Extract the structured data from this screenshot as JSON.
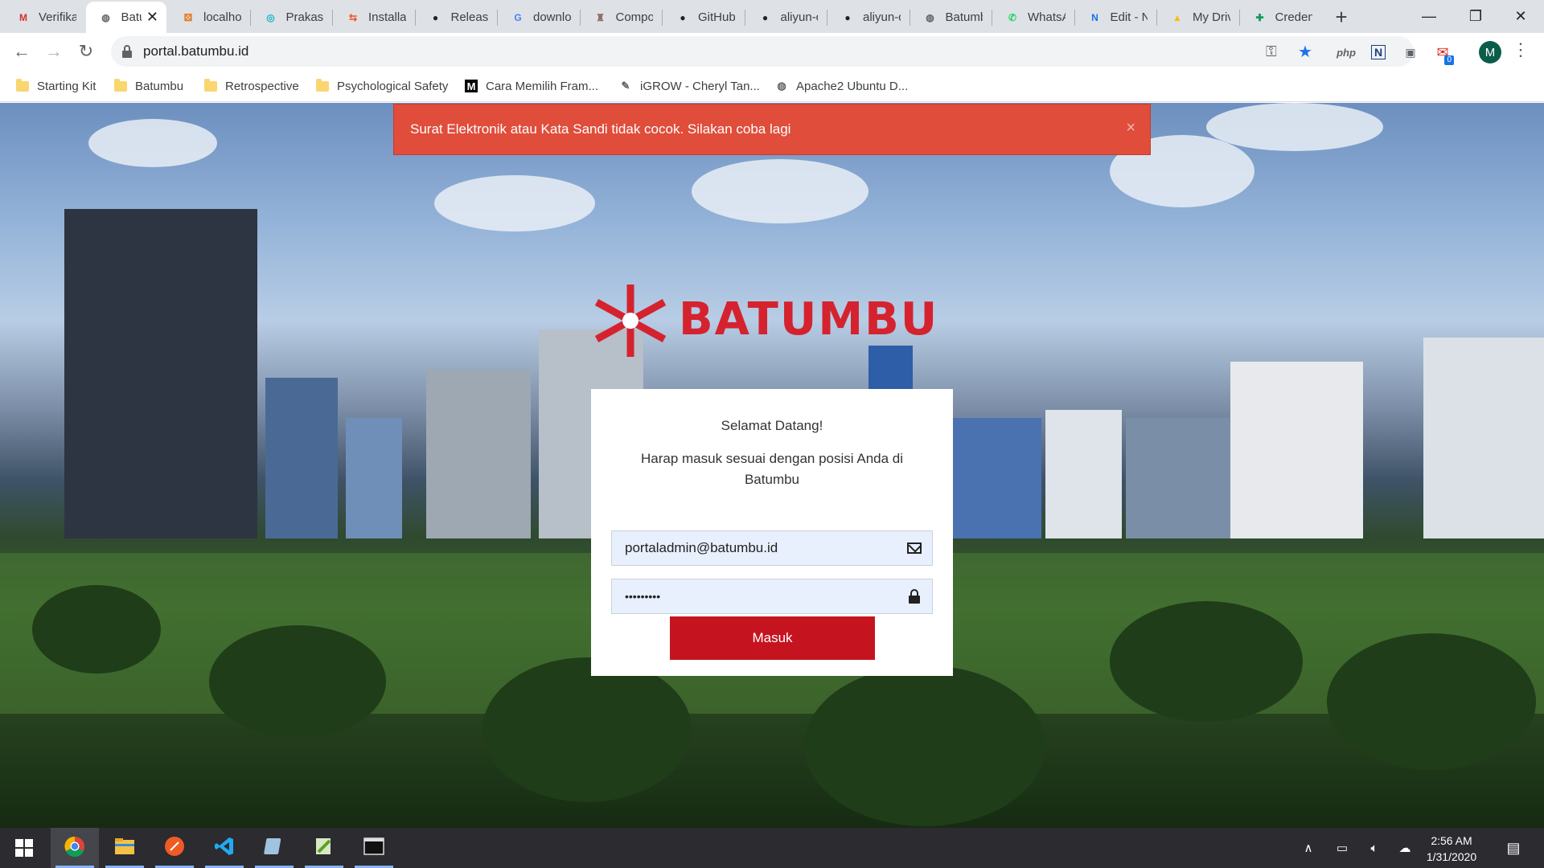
{
  "browser": {
    "tabs": [
      {
        "title": "Verifika",
        "icon": "gmail-icon",
        "color": "#d93025",
        "glyph": "M"
      },
      {
        "title": "Batu",
        "icon": "globe-icon",
        "color": "#5f6368",
        "glyph": "◍",
        "active": true
      },
      {
        "title": "localho",
        "icon": "localhost-icon",
        "color": "#e8710a",
        "glyph": "⚄"
      },
      {
        "title": "Prakash",
        "icon": "prakash-icon",
        "color": "#12b5cb",
        "glyph": "◎"
      },
      {
        "title": "Installat",
        "icon": "installation-icon",
        "color": "#f4511e",
        "glyph": "⇆"
      },
      {
        "title": "Release",
        "icon": "github-icon",
        "color": "#202124",
        "glyph": "●"
      },
      {
        "title": "downlo",
        "icon": "google-icon",
        "color": "#4285f4",
        "glyph": "G"
      },
      {
        "title": "Compo",
        "icon": "composer-icon",
        "color": "#8d6e63",
        "glyph": "♜"
      },
      {
        "title": "GitHub",
        "icon": "github-icon",
        "color": "#202124",
        "glyph": "●"
      },
      {
        "title": "aliyun-c",
        "icon": "github-icon",
        "color": "#202124",
        "glyph": "●"
      },
      {
        "title": "aliyun-c",
        "icon": "github-icon",
        "color": "#202124",
        "glyph": "●"
      },
      {
        "title": "Batumb",
        "icon": "globe-icon",
        "color": "#5f6368",
        "glyph": "◍"
      },
      {
        "title": "WhatsA",
        "icon": "whatsapp-icon",
        "color": "#25d366",
        "glyph": "✆"
      },
      {
        "title": "Edit - N",
        "icon": "notion-icon",
        "color": "#1a73e8",
        "glyph": "N"
      },
      {
        "title": "My Driv",
        "icon": "google-drive-icon",
        "color": "#fbbc04",
        "glyph": "▲"
      },
      {
        "title": "Credent",
        "icon": "google-sheets-icon",
        "color": "#0f9d58",
        "glyph": "✚"
      }
    ],
    "new_tab_label": "+",
    "window_controls": {
      "minimize": "—",
      "maximize": "❐",
      "close": "✕"
    },
    "url": "portal.batumbu.id",
    "extensions": [
      {
        "name": "php-extension-icon",
        "glyph": "php"
      },
      {
        "name": "n-extension-icon",
        "glyph": "N"
      },
      {
        "name": "gray-extension-icon",
        "glyph": "▣"
      },
      {
        "name": "red-extension-icon",
        "glyph": "✉",
        "badge": "0"
      }
    ],
    "profile_initial": "M",
    "bookmarks": [
      {
        "label": "Starting Kit",
        "type": "folder"
      },
      {
        "label": "Batumbu",
        "type": "folder"
      },
      {
        "label": "Retrospective",
        "type": "folder"
      },
      {
        "label": "Psychological Safety",
        "type": "folder"
      },
      {
        "label": "Cara Memilih Fram...",
        "type": "medium",
        "glyph": "M"
      },
      {
        "label": "iGROW - Cheryl Tan...",
        "type": "feather",
        "glyph": "✎"
      },
      {
        "label": "Apache2 Ubuntu D...",
        "type": "globe",
        "glyph": "◍"
      }
    ]
  },
  "page": {
    "alert_message": "Surat Elektronik atau Kata Sandi tidak cocok. Silakan coba lagi",
    "alert_close": "×",
    "brand_name": "BATUMBU",
    "brand_color": "#d4232f",
    "welcome": "Selamat Datang!",
    "instruction": "Harap masuk sesuai dengan posisi Anda di Batumbu",
    "email_value": "portaladmin@batumbu.id",
    "password_value": "•••••••••",
    "submit_label": "Masuk",
    "submit_color": "#c5141f",
    "alert_color": "#e04d3b"
  },
  "taskbar": {
    "apps": [
      {
        "name": "chrome-icon",
        "active": true
      },
      {
        "name": "file-explorer-icon"
      },
      {
        "name": "postman-icon"
      },
      {
        "name": "vscode-icon"
      },
      {
        "name": "generic-app-icon"
      },
      {
        "name": "notepad-plus-icon"
      },
      {
        "name": "terminal-icon"
      }
    ],
    "time": "2:56 AM",
    "date": "1/31/2020"
  }
}
